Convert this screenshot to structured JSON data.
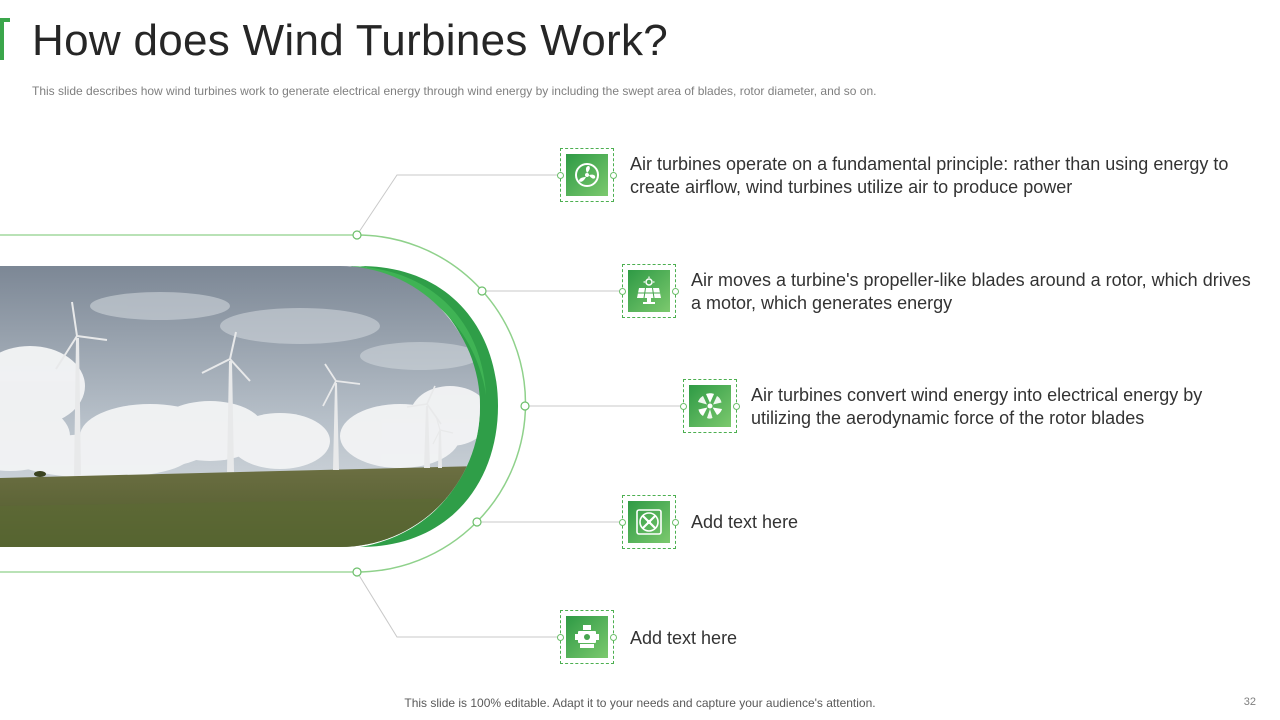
{
  "slide": {
    "title": "How does Wind Turbines Work?",
    "subtitle": "This slide describes how wind turbines work to generate electrical energy through wind energy by including the swept area of blades, rotor diameter, and so on.",
    "footer": "This slide is 100% editable. Adapt it to your needs and capture your audience's attention.",
    "page_number": "32"
  },
  "colors": {
    "accent": "#3aa64b",
    "line": "#8fd18b",
    "icon_gradient_start": "#2e9a45",
    "icon_gradient_end": "#7cc96e"
  },
  "items": [
    {
      "icon": "fan-icon",
      "text": "Air turbines operate on a fundamental principle: rather than using energy to create airflow, wind turbines utilize air to produce power"
    },
    {
      "icon": "solar-panel-icon",
      "text": "Air moves a turbine's propeller-like blades around a rotor, which drives a motor, which generates energy"
    },
    {
      "icon": "turbine-blades-icon",
      "text": "Air turbines convert wind energy into electrical energy by utilizing the aerodynamic force of the rotor blades"
    },
    {
      "icon": "circular-fan-icon",
      "text": "Add text here"
    },
    {
      "icon": "engine-icon",
      "text": "Add text here"
    }
  ]
}
